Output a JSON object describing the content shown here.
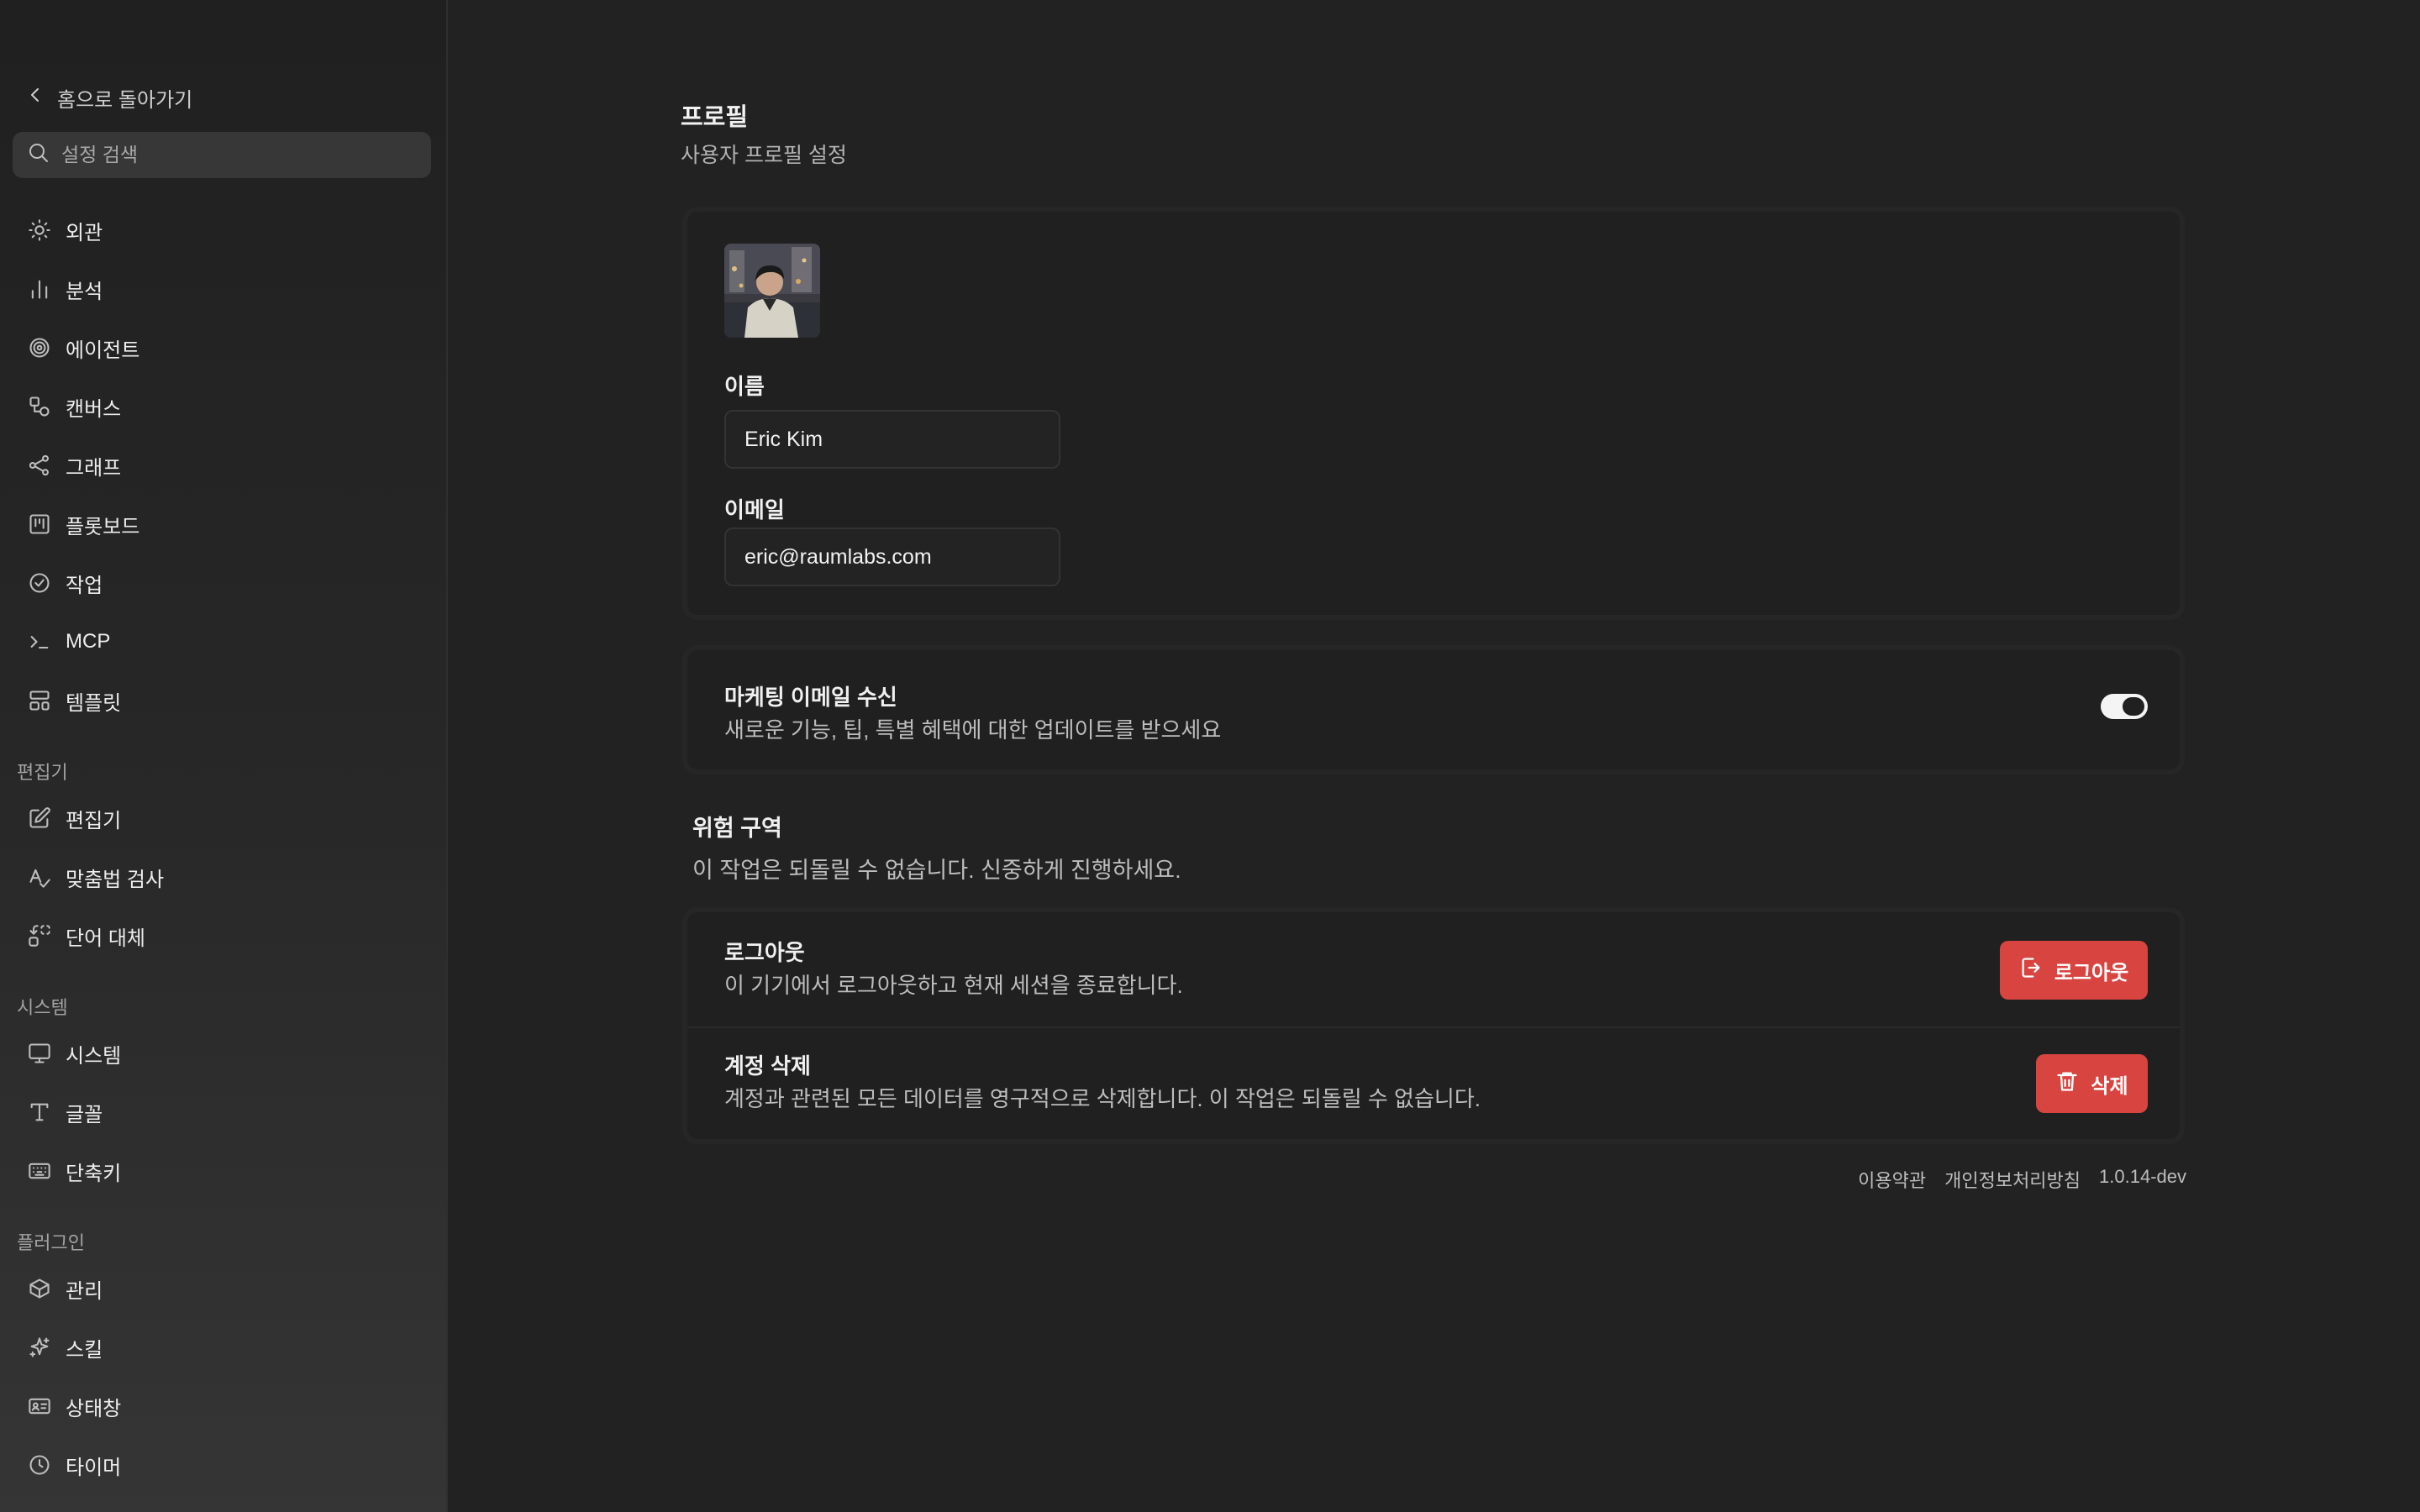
{
  "sidebar": {
    "back_label": "홈으로 돌아가기",
    "search_placeholder": "설정 검색",
    "items": [
      {
        "label": "외관",
        "icon": "sun-icon"
      },
      {
        "label": "분석",
        "icon": "bar-chart-icon"
      },
      {
        "label": "에이전트",
        "icon": "spiral-icon"
      },
      {
        "label": "캔버스",
        "icon": "shapes-icon"
      },
      {
        "label": "그래프",
        "icon": "graph-icon"
      },
      {
        "label": "플롯보드",
        "icon": "kanban-icon"
      },
      {
        "label": "작업",
        "icon": "check-circle-icon"
      },
      {
        "label": "MCP",
        "icon": "terminal-icon"
      },
      {
        "label": "템플릿",
        "icon": "layout-icon"
      }
    ],
    "sections": {
      "editor": {
        "label": "편집기",
        "items": [
          {
            "label": "편집기",
            "icon": "edit-icon"
          },
          {
            "label": "맞춤법 검사",
            "icon": "spell-check-icon"
          },
          {
            "label": "단어 대체",
            "icon": "replace-icon"
          }
        ]
      },
      "system": {
        "label": "시스템",
        "items": [
          {
            "label": "시스템",
            "icon": "monitor-icon"
          },
          {
            "label": "글꼴",
            "icon": "type-icon"
          },
          {
            "label": "단축키",
            "icon": "keyboard-icon"
          }
        ]
      },
      "plugins": {
        "label": "플러그인",
        "items": [
          {
            "label": "관리",
            "icon": "box-icon"
          },
          {
            "label": "스킬",
            "icon": "sparkles-icon"
          },
          {
            "label": "상태창",
            "icon": "id-card-icon"
          },
          {
            "label": "타이머",
            "icon": "clock-icon"
          }
        ]
      }
    }
  },
  "page": {
    "title": "프로필",
    "subtitle": "사용자 프로필 설정"
  },
  "profile": {
    "name_label": "이름",
    "name_value": "Eric Kim",
    "email_label": "이메일",
    "email_value": "eric@raumlabs.com"
  },
  "marketing": {
    "title": "마케팅 이메일 수신",
    "description": "새로운 기능, 팁, 특별 혜택에 대한 업데이트를 받으세요",
    "enabled": true
  },
  "danger_zone": {
    "title": "위험 구역",
    "description": "이 작업은 되돌릴 수 없습니다. 신중하게 진행하세요.",
    "logout": {
      "title": "로그아웃",
      "description": "이 기기에서 로그아웃하고 현재 세션을 종료합니다.",
      "button_label": "로그아웃"
    },
    "delete": {
      "title": "계정 삭제",
      "description": "계정과 관련된 모든 데이터를 영구적으로 삭제합니다. 이 작업은 되돌릴 수 없습니다.",
      "button_label": "삭제"
    }
  },
  "footer": {
    "terms": "이용약관",
    "privacy": "개인정보처리방침",
    "version": "1.0.14-dev"
  },
  "colors": {
    "danger": "#d8443f",
    "background": "#222222",
    "sidebar": "#202020"
  }
}
